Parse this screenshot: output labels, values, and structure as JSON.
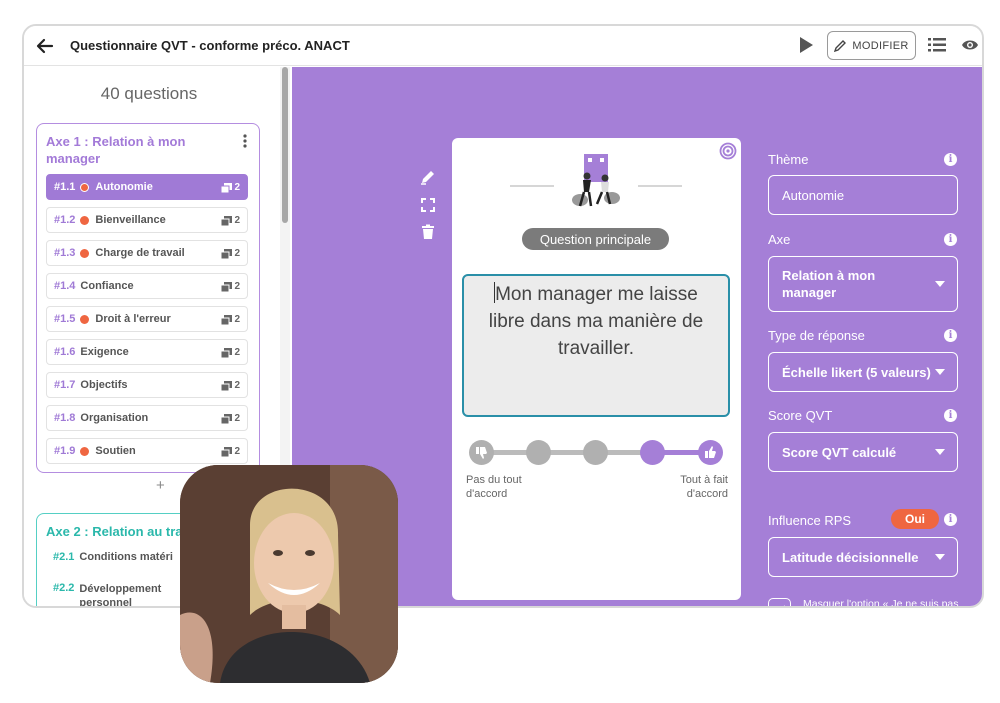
{
  "app": {
    "title": "Questionnaire QVT - conforme préco. ANACT",
    "modifier_label": "MODIFIER"
  },
  "sidebar": {
    "question_count": "40 questions",
    "axe1": {
      "title": "Axe 1 : Relation à mon manager",
      "questions": [
        {
          "num": "#1.1",
          "label": "Autonomie",
          "dot": true,
          "copies": "2"
        },
        {
          "num": "#1.2",
          "label": "Bienveillance",
          "dot": true,
          "copies": "2"
        },
        {
          "num": "#1.3",
          "label": "Charge de travail",
          "dot": true,
          "copies": "2"
        },
        {
          "num": "#1.4",
          "label": "Confiance",
          "dot": false,
          "copies": "2"
        },
        {
          "num": "#1.5",
          "label": "Droit à l'erreur",
          "dot": true,
          "copies": "2"
        },
        {
          "num": "#1.6",
          "label": "Exigence",
          "dot": false,
          "copies": "2"
        },
        {
          "num": "#1.7",
          "label": "Objectifs",
          "dot": false,
          "copies": "2"
        },
        {
          "num": "#1.8",
          "label": "Organisation",
          "dot": false,
          "copies": "2"
        },
        {
          "num": "#1.9",
          "label": "Soutien",
          "dot": true,
          "copies": "2"
        }
      ]
    },
    "add_label": "+",
    "axe2": {
      "title": "Axe 2 : Relation au tra",
      "questions": [
        {
          "num": "#2.1",
          "label": "Conditions matéri"
        },
        {
          "num": "#2.2",
          "label": "Développement personnel"
        }
      ]
    }
  },
  "card": {
    "tag": "Question principale",
    "question_text": "Mon manager me laisse libre dans ma manière de travailler.",
    "scale_left": "Pas du tout d'accord",
    "scale_right": "Tout à fait d'accord",
    "add_label": "+"
  },
  "panel": {
    "theme_label": "Thème",
    "theme_value": "Autonomie",
    "axe_label": "Axe",
    "axe_value": "Relation à mon manager",
    "response_type_label": "Type de réponse",
    "response_type_value": "Échelle likert (5 valeurs)",
    "score_label": "Score QVT",
    "score_value": "Score QVT calculé",
    "rps_label": "Influence RPS",
    "rps_badge": "Oui",
    "rps_value": "Latitude décisionnelle",
    "hide_option_label": "Masquer l'option « Je ne suis pas concerné·e ».",
    "info_glyph": "i"
  },
  "colors": {
    "accent": "#a57fd7",
    "orange": "#ef6641",
    "teal": "#2bb8ab"
  }
}
